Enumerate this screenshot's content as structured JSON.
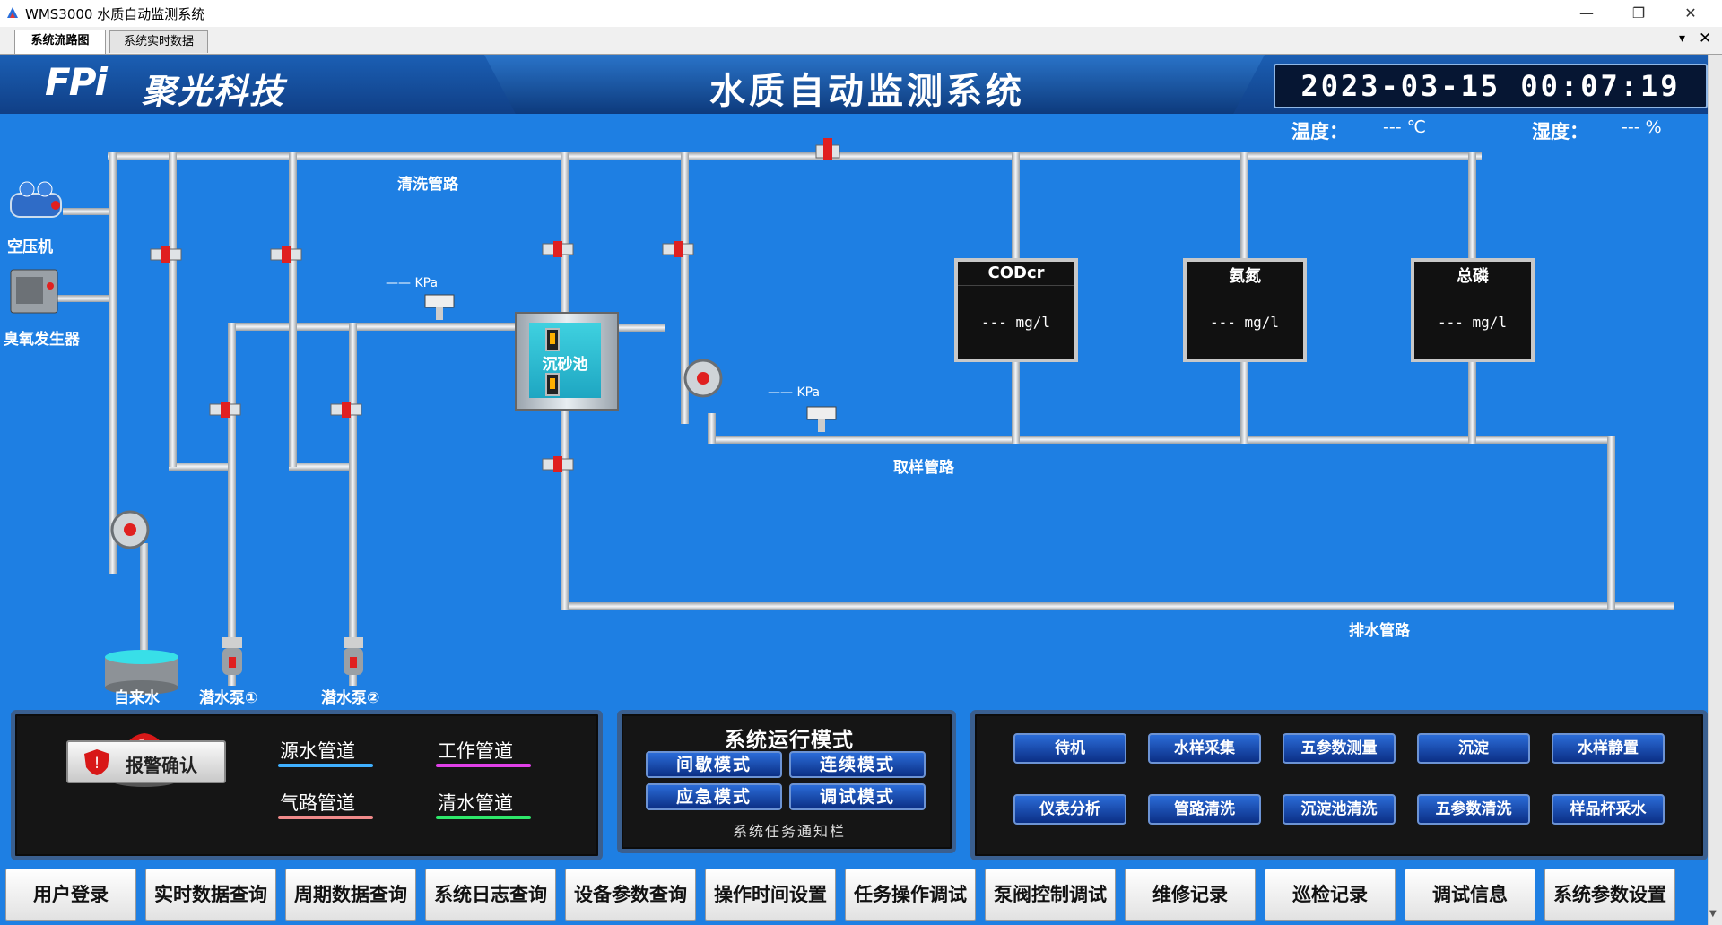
{
  "window": {
    "title": "WMS3000 水质自动监测系统",
    "min": "—",
    "restore": "❐",
    "close": "✕"
  },
  "tabs": [
    {
      "label": "系统流路图",
      "active": true
    },
    {
      "label": "系统实时数据",
      "active": false
    }
  ],
  "tab_controls": {
    "menu": "▾",
    "close": "✕"
  },
  "header": {
    "logo": "FPi",
    "company": "聚光科技",
    "title": "水质自动监测系统",
    "datetime": "2023-03-15 00:07:19"
  },
  "environment": {
    "temp_label": "温度：",
    "temp_value": "---  ℃",
    "humidity_label": "湿度：",
    "humidity_value": "---  %"
  },
  "diagram": {
    "compressor_label": "空压机",
    "ozone_label": "臭氧发生器",
    "clean_pipe_label": "清洗管路",
    "sample_pipe_label": "取样管路",
    "drain_pipe_label": "排水管路",
    "tank_label": "沉砂池",
    "pressure1": "—— KPa",
    "pressure2": "—— KPa",
    "tap_water_label": "自来水",
    "pump1_label": "潜水泵①",
    "pump2_label": "潜水泵②"
  },
  "analyzers": [
    {
      "name": "CODcr",
      "value": "---  mg/l"
    },
    {
      "name": "氨氮",
      "value": "---  mg/l"
    },
    {
      "name": "总磷",
      "value": "---  mg/l"
    }
  ],
  "legend": {
    "source_pipe": "源水管道",
    "work_pipe": "工作管道",
    "air_pipe": "气路管道",
    "clean_water_pipe": "清水管道",
    "colors": {
      "source": "#3fb0ff",
      "work": "#e040e8",
      "air": "#f08a8a",
      "clean": "#2ee86a"
    }
  },
  "alarm_button": "报警确认",
  "run_mode": {
    "title": "系统运行模式",
    "modes": [
      "间歇模式",
      "连续模式",
      "应急模式",
      "调试模式"
    ],
    "notice": "系统任务通知栏"
  },
  "steps": [
    "待机",
    "水样采集",
    "五参数测量",
    "沉淀",
    "水样静置",
    "仪表分析",
    "管路清洗",
    "沉淀池清洗",
    "五参数清洗",
    "样品杯采水"
  ],
  "menu": [
    "用户登录",
    "实时数据查询",
    "周期数据查询",
    "系统日志查询",
    "设备参数查询",
    "操作时间设置",
    "任务操作调试",
    "泵阀控制调试",
    "维修记录",
    "巡检记录",
    "调试信息",
    "系统参数设置"
  ],
  "icons": {
    "app": "app-icon",
    "alarm_light": "alarm-light-icon",
    "alarm_shield": "alarm-shield-icon",
    "pump": "pump-icon",
    "valve": "valve-icon"
  },
  "colors": {
    "background": "#1e7fe3",
    "header": "#103f86",
    "pipe": "#d9dde2",
    "valve": "#e02020"
  }
}
